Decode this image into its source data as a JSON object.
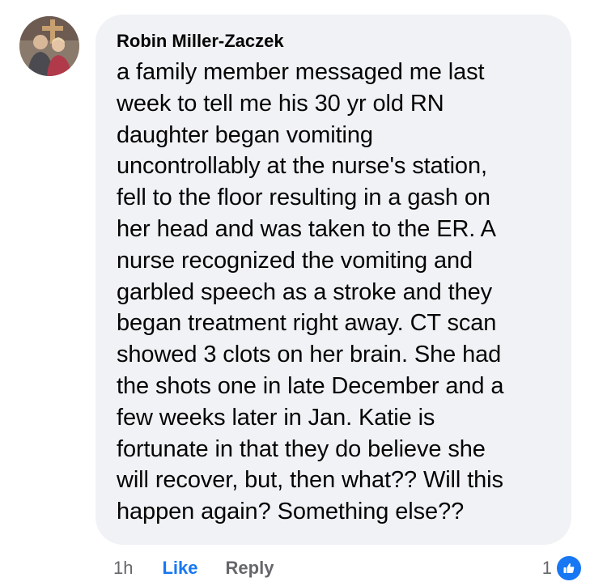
{
  "comment": {
    "author": "Robin Miller-Zaczek",
    "lines": [
      "a family member messaged me last",
      "week to tell me his 30 yr old RN",
      "daughter began vomiting",
      "uncontrollably at the nurse's station,",
      "fell to the floor resulting in a gash on",
      "her head and was taken to the ER. A",
      "nurse recognized the vomiting and",
      "garbled speech as a stroke and they",
      "began treatment right away. CT scan",
      "showed 3 clots on her brain. She had",
      "the shots one in late December and a",
      "few weeks later in Jan. Katie is",
      "fortunate in that they do believe she",
      "will recover, but, then what?? Will this",
      "happen again? Something else??"
    ],
    "avatar_icon": "profile-photo",
    "bubble_color": "#f0f2f5"
  },
  "actions": {
    "time": "1h",
    "like_label": "Like",
    "reply_label": "Reply",
    "like_color": "#1877f2"
  },
  "reactions": {
    "count": "1",
    "icon": "thumbs-up-icon"
  }
}
